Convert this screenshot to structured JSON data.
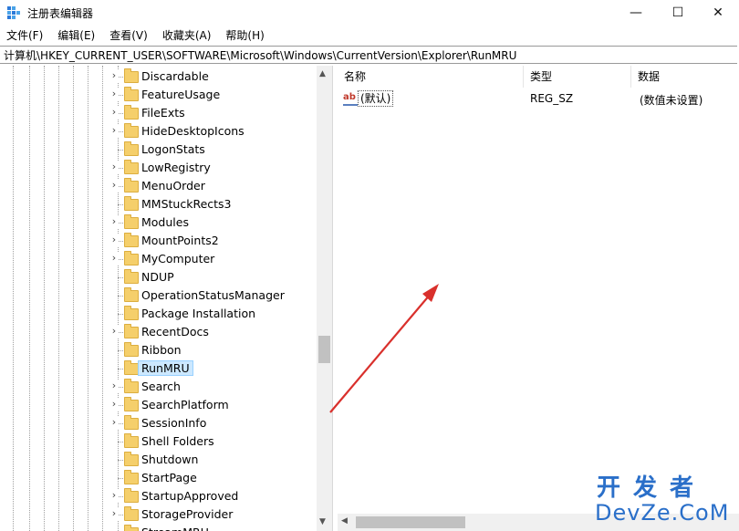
{
  "window": {
    "title": "注册表编辑器",
    "minimize": "—",
    "maximize": "☐",
    "close": "✕"
  },
  "menu": [
    "文件(F)",
    "编辑(E)",
    "查看(V)",
    "收藏夹(A)",
    "帮助(H)"
  ],
  "address": "计算机\\HKEY_CURRENT_USER\\SOFTWARE\\Microsoft\\Windows\\CurrentVersion\\Explorer\\RunMRU",
  "tree": [
    {
      "label": "Discardable",
      "expandable": true
    },
    {
      "label": "FeatureUsage",
      "expandable": true
    },
    {
      "label": "FileExts",
      "expandable": true
    },
    {
      "label": "HideDesktopIcons",
      "expandable": true
    },
    {
      "label": "LogonStats",
      "expandable": false
    },
    {
      "label": "LowRegistry",
      "expandable": true
    },
    {
      "label": "MenuOrder",
      "expandable": true
    },
    {
      "label": "MMStuckRects3",
      "expandable": false
    },
    {
      "label": "Modules",
      "expandable": true
    },
    {
      "label": "MountPoints2",
      "expandable": true
    },
    {
      "label": "MyComputer",
      "expandable": true
    },
    {
      "label": "NDUP",
      "expandable": false
    },
    {
      "label": "OperationStatusManager",
      "expandable": false
    },
    {
      "label": "Package Installation",
      "expandable": false
    },
    {
      "label": "RecentDocs",
      "expandable": true
    },
    {
      "label": "Ribbon",
      "expandable": false
    },
    {
      "label": "RunMRU",
      "expandable": false,
      "selected": true
    },
    {
      "label": "Search",
      "expandable": true
    },
    {
      "label": "SearchPlatform",
      "expandable": true
    },
    {
      "label": "SessionInfo",
      "expandable": true
    },
    {
      "label": "Shell Folders",
      "expandable": false
    },
    {
      "label": "Shutdown",
      "expandable": false
    },
    {
      "label": "StartPage",
      "expandable": false
    },
    {
      "label": "StartupApproved",
      "expandable": true
    },
    {
      "label": "StorageProvider",
      "expandable": true
    },
    {
      "label": "StreamMRU",
      "expandable": false
    }
  ],
  "list": {
    "columns": {
      "name": "名称",
      "type": "类型",
      "data": "数据"
    },
    "rows": [
      {
        "icon": "ab",
        "name": "(默认)",
        "type": "REG_SZ",
        "data": "(数值未设置)"
      }
    ]
  },
  "watermark": {
    "top": "开发者",
    "bottom": "DevZe.CoM"
  },
  "colors": {
    "folder": "#f5cf6b",
    "selection": "#cce8ff",
    "arrow": "#d9302c",
    "watermark": "#2a6fc9"
  }
}
